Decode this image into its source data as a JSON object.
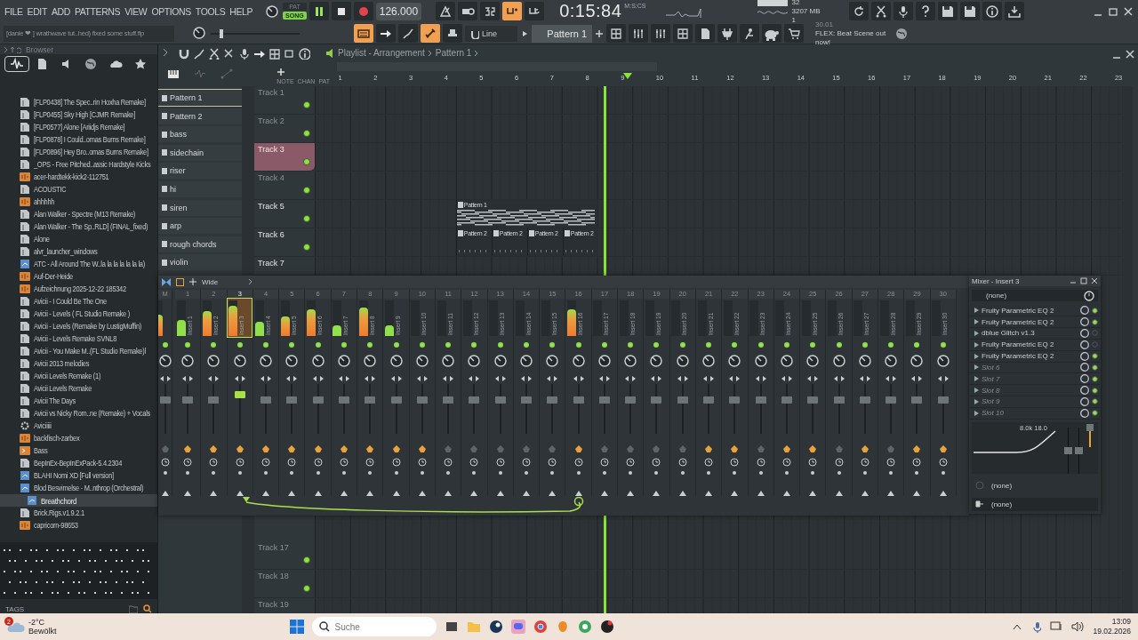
{
  "top": {
    "menu": [
      "FILE",
      "EDIT",
      "ADD",
      "PATTERNS",
      "VIEW",
      "OPTIONS",
      "TOOLS",
      "HELP"
    ],
    "modes": [
      {
        "label": "PAT",
        "selected": false
      },
      {
        "label": "SONG",
        "selected": true
      }
    ],
    "playing": true,
    "tempo": "126.000",
    "time": "0:15:84",
    "time_unit": "M:S:CS",
    "cpu": {
      "polyphony": "32",
      "memory": "3207 MB",
      "voices": "1"
    },
    "toggles": [
      {
        "kind": "metronome",
        "on": false
      },
      {
        "kind": "wait",
        "on": false
      },
      {
        "kind": "countdown",
        "on": false
      },
      {
        "kind": "blend",
        "on": true
      },
      {
        "kind": "loop",
        "on": false
      }
    ],
    "hint": "[danie ❤ ] wrathwave tut..hed) fixed some stuff.flp",
    "master_pitch": {
      "level": 0.1
    },
    "toggles2": [
      {
        "kind": "playlist",
        "on": true
      },
      {
        "kind": "arrow",
        "on": false
      },
      {
        "kind": "brush",
        "on": false
      },
      {
        "kind": "link",
        "on": true
      },
      {
        "kind": "stamp",
        "on": false
      }
    ],
    "snap": "Line",
    "pattern": "Pattern 1",
    "news": {
      "date": "30.01",
      "text": "FLEX: Beat Scene out now!"
    }
  },
  "browser": {
    "title": "Browser",
    "tabs": [
      {
        "kind": "all",
        "selected": true
      },
      {
        "kind": "files",
        "selected": false
      },
      {
        "kind": "speaker",
        "selected": false
      },
      {
        "kind": "globe",
        "selected": false
      },
      {
        "kind": "cloud",
        "selected": false
      },
      {
        "kind": "star",
        "selected": false
      }
    ],
    "items": [
      {
        "label": "[FLP0438] The Spec..rin Hoxha Remake]",
        "kind": "folder",
        "selected": false
      },
      {
        "label": "[FLP0455] Sky High [CJMR Remake]",
        "kind": "folder",
        "selected": false
      },
      {
        "label": "[FLP0577] Alone [Ariidjs Remake]",
        "kind": "folder",
        "selected": false
      },
      {
        "label": "[FLP0878] I Could..omas Burns Remake]",
        "kind": "folder",
        "selected": false
      },
      {
        "label": "[FLP0896] Hey Bro..omas Burns Remake]",
        "kind": "folder",
        "selected": false
      },
      {
        "label": "_OPS - Free Pitched..assic Hardstyle Kicks",
        "kind": "folder",
        "selected": false
      },
      {
        "label": "acer-hardtekk-kick2-112751",
        "kind": "audio",
        "selected": false
      },
      {
        "label": "ACOUSTIC",
        "kind": "folder",
        "selected": false
      },
      {
        "label": "ahhhhh",
        "kind": "audio",
        "selected": false
      },
      {
        "label": "Alan Walker - Spectre (M13 Remake)",
        "kind": "folder",
        "selected": false
      },
      {
        "label": "Alan Walker - The Sp..RLD] (FINAL_fixed)",
        "kind": "folder",
        "selected": false
      },
      {
        "label": "Alone",
        "kind": "folder",
        "selected": false
      },
      {
        "label": "alvr_launcher_windows",
        "kind": "folder",
        "selected": false
      },
      {
        "label": "ATC - All Around The W..la la la la la la la)",
        "kind": "project",
        "selected": false
      },
      {
        "label": "Auf-Der-Heide",
        "kind": "audio",
        "selected": false
      },
      {
        "label": "Aufzeichnung 2025-12-22 185342",
        "kind": "audio",
        "selected": false
      },
      {
        "label": "Avicii - I Could Be The One",
        "kind": "folder",
        "selected": false
      },
      {
        "label": "Avicii - Levels ( FL Studio Remake )",
        "kind": "folder",
        "selected": false
      },
      {
        "label": "Avicii - Levels (Remake by LustigMuffin)",
        "kind": "folder",
        "selected": false
      },
      {
        "label": "Avicii - Levels Remake SVNL8",
        "kind": "folder",
        "selected": false
      },
      {
        "label": "Avicii - You Make M..(FL Studio Remake)l",
        "kind": "folder",
        "selected": false
      },
      {
        "label": "Avicii 2013 melodies",
        "kind": "folder",
        "selected": false
      },
      {
        "label": "Avicii Levels Remake (1)",
        "kind": "folder",
        "selected": false
      },
      {
        "label": "Avicii Levels Remake",
        "kind": "folder",
        "selected": false
      },
      {
        "label": "Avicii The Days",
        "kind": "folder",
        "selected": false
      },
      {
        "label": "Avicii vs Nicky Rom..ne (Remake) + Vocals",
        "kind": "folder",
        "selected": false
      },
      {
        "label": "Aviciiiii",
        "kind": "gear",
        "selected": false
      },
      {
        "label": "backfisch-zarbex",
        "kind": "audio",
        "selected": false
      },
      {
        "label": "Bass",
        "kind": "pack",
        "selected": false
      },
      {
        "label": "BepInEx-BepInExPack-5.4.2304",
        "kind": "folder",
        "selected": false
      },
      {
        "label": "BLAHI Nomi XD [Full version]",
        "kind": "project",
        "selected": false
      },
      {
        "label": "Blod Besvimelse - M..nthrop (Orchestral)",
        "kind": "project",
        "selected": false
      },
      {
        "label": "Breathchord",
        "kind": "project",
        "selected": true
      },
      {
        "label": "Brick.Rigs.v1.9.2.1",
        "kind": "folder",
        "selected": false
      },
      {
        "label": "capricorn-98653",
        "kind": "audio",
        "selected": false
      }
    ],
    "tags_label": "TAGS"
  },
  "playlist": {
    "title": "Playlist - Arrangement",
    "crumb": "Pattern 1",
    "tool_labels": [
      "NOTE",
      "CHAN",
      "PAT"
    ],
    "patterns": [
      {
        "label": "Pattern 1",
        "selected": true
      },
      {
        "label": "Pattern 2",
        "selected": false
      },
      {
        "label": "bass",
        "selected": false
      },
      {
        "label": "sidechain",
        "selected": false
      },
      {
        "label": "riser",
        "selected": false
      },
      {
        "label": "hi",
        "selected": false
      },
      {
        "label": "siren",
        "selected": false
      },
      {
        "label": "arp",
        "selected": false
      },
      {
        "label": "rough chords",
        "selected": false
      },
      {
        "label": "violin",
        "selected": false
      }
    ],
    "ruler": [
      "1",
      "2",
      "3",
      "4",
      "5",
      "6",
      "7",
      "8",
      "9",
      "10",
      "11",
      "12",
      "13",
      "14",
      "15",
      "16",
      "17",
      "18",
      "19",
      "20",
      "21",
      "22",
      "23"
    ],
    "playhead": {
      "level": 0.359
    },
    "tracks": [
      {
        "label": "Track 1",
        "selected": false,
        "dimmed": true
      },
      {
        "label": "Track 2",
        "selected": false,
        "dimmed": true
      },
      {
        "label": "Track 3",
        "selected": true,
        "dimmed": true
      },
      {
        "label": "Track 4",
        "selected": false,
        "dimmed": true
      },
      {
        "label": "Track 5",
        "selected": false,
        "dimmed": false,
        "clips": [
          {
            "label": "Pattern 1",
            "kind": "notes"
          }
        ]
      },
      {
        "label": "Track 6",
        "selected": false,
        "dimmed": false,
        "clips": [
          {
            "label": "Pattern 2",
            "kind": "empty"
          },
          {
            "label": "Pattern 2",
            "kind": "empty"
          },
          {
            "label": "Pattern 2",
            "kind": "empty"
          },
          {
            "label": "Pattern 2",
            "kind": "empty"
          }
        ]
      },
      {
        "label": "Track 7",
        "selected": false,
        "dimmed": false
      }
    ],
    "lower_tracks": [
      {
        "label": "Track 17",
        "selected": false,
        "dimmed": true
      },
      {
        "label": "Track 18",
        "selected": false,
        "dimmed": true
      },
      {
        "label": "Track 19",
        "selected": false,
        "dimmed": true
      }
    ]
  },
  "mixer": {
    "title": "Wide",
    "strips": [
      {
        "kind": "master",
        "number": "M",
        "level": 0.6,
        "selected": false,
        "send": false
      },
      {
        "kind": "insert",
        "number": "1",
        "label": "Insert 1",
        "level": 0.45,
        "selected": false,
        "send": true
      },
      {
        "kind": "insert",
        "number": "2",
        "label": "Insert 2",
        "level": 0.7,
        "selected": false,
        "send": true
      },
      {
        "kind": "insert",
        "number": "3",
        "label": "Insert 3",
        "level": 0.85,
        "selected": true,
        "send": true
      },
      {
        "kind": "insert",
        "number": "4",
        "label": "Insert 4",
        "level": 0.4,
        "selected": false,
        "send": true
      },
      {
        "kind": "insert",
        "number": "5",
        "label": "Insert 5",
        "level": 0.55,
        "selected": false,
        "send": true
      },
      {
        "kind": "insert",
        "number": "6",
        "label": "Insert 6",
        "level": 0.75,
        "selected": false,
        "send": true
      },
      {
        "kind": "insert",
        "number": "7",
        "label": "Insert 7",
        "level": 0.3,
        "selected": false,
        "send": true
      },
      {
        "kind": "insert",
        "number": "8",
        "label": "Insert 8",
        "level": 0.8,
        "selected": false,
        "send": true
      },
      {
        "kind": "insert",
        "number": "9",
        "label": "Insert 9",
        "level": 0.3,
        "selected": false,
        "send": true
      },
      {
        "kind": "insert",
        "number": "10",
        "label": "Insert 10",
        "level": 0,
        "selected": false,
        "send": true
      },
      {
        "kind": "insert",
        "number": "11",
        "label": "Insert 11",
        "level": 0,
        "selected": false,
        "send": false
      },
      {
        "kind": "insert",
        "number": "12",
        "label": "Insert 12",
        "level": 0,
        "selected": false,
        "send": false
      },
      {
        "kind": "insert",
        "number": "13",
        "label": "Insert 13",
        "level": 0,
        "selected": false,
        "send": false
      },
      {
        "kind": "insert",
        "number": "14",
        "label": "Insert 14",
        "level": 0,
        "selected": false,
        "send": false
      },
      {
        "kind": "insert",
        "number": "15",
        "label": "Insert 15",
        "level": 0,
        "selected": false,
        "send": false
      },
      {
        "kind": "insert",
        "number": "16",
        "label": "Insert 16",
        "level": 0.75,
        "selected": false,
        "send": true
      },
      {
        "kind": "insert",
        "number": "17",
        "label": "Insert 17",
        "level": 0,
        "selected": false,
        "send": false
      },
      {
        "kind": "insert",
        "number": "18",
        "label": "Insert 18",
        "level": 0,
        "selected": false,
        "send": false
      },
      {
        "kind": "insert",
        "number": "19",
        "label": "Insert 19",
        "level": 0,
        "selected": false,
        "send": false
      },
      {
        "kind": "insert",
        "number": "20",
        "label": "Insert 20",
        "level": 0,
        "selected": false,
        "send": false
      },
      {
        "kind": "insert",
        "number": "21",
        "label": "Insert 21",
        "level": 0,
        "selected": false,
        "send": true
      },
      {
        "kind": "insert",
        "number": "22",
        "label": "Insert 22",
        "level": 0,
        "selected": false,
        "send": true
      },
      {
        "kind": "insert",
        "number": "23",
        "label": "Insert 23",
        "level": 0,
        "selected": false,
        "send": false
      },
      {
        "kind": "insert",
        "number": "24",
        "label": "Insert 24",
        "level": 0,
        "selected": false,
        "send": true
      },
      {
        "kind": "insert",
        "number": "25",
        "label": "Insert 25",
        "level": 0,
        "selected": false,
        "send": true
      },
      {
        "kind": "insert",
        "number": "26",
        "label": "Insert 26",
        "level": 0,
        "selected": false,
        "send": false
      },
      {
        "kind": "insert",
        "number": "27",
        "label": "Insert 27",
        "level": 0,
        "selected": false,
        "send": true
      },
      {
        "kind": "insert",
        "number": "28",
        "label": "Insert 28",
        "level": 0,
        "selected": false,
        "send": false
      },
      {
        "kind": "insert",
        "number": "29",
        "label": "Insert 29",
        "level": 0,
        "selected": false,
        "send": true
      },
      {
        "kind": "insert",
        "number": "30",
        "label": "Insert 30",
        "level": 0,
        "selected": false,
        "send": true
      }
    ]
  },
  "insert": {
    "title": "Mixer - Insert 3",
    "input": "(none)",
    "slots": [
      {
        "label": "Fruity Parametric EQ 2",
        "kind": "plugin",
        "on": true
      },
      {
        "label": "Fruity Parametric EQ 2",
        "kind": "plugin",
        "on": true
      },
      {
        "label": "dblue Glitch v1.3",
        "kind": "plugin",
        "on": false
      },
      {
        "label": "Fruity Parametric EQ 2",
        "kind": "plugin",
        "on": false
      },
      {
        "label": "Fruity Parametric EQ 2",
        "kind": "plugin",
        "on": true
      },
      {
        "label": "Slot 6",
        "kind": "empty",
        "on": true
      },
      {
        "label": "Slot 7",
        "kind": "empty",
        "on": true
      },
      {
        "label": "Slot 8",
        "kind": "empty",
        "on": true
      },
      {
        "label": "Slot 9",
        "kind": "empty",
        "on": true
      },
      {
        "label": "Slot 10",
        "kind": "empty",
        "on": true
      }
    ],
    "eq_label": "8.0k 18.0",
    "sidechain": "(none)",
    "output": "(none)"
  },
  "taskbar": {
    "weather": {
      "temp": "-2°C",
      "condition": "Bewölkt",
      "badge": "2"
    },
    "search": {
      "placeholder": "Suche"
    },
    "clock": {
      "time": "13:09",
      "date": "19.02.2026"
    }
  }
}
